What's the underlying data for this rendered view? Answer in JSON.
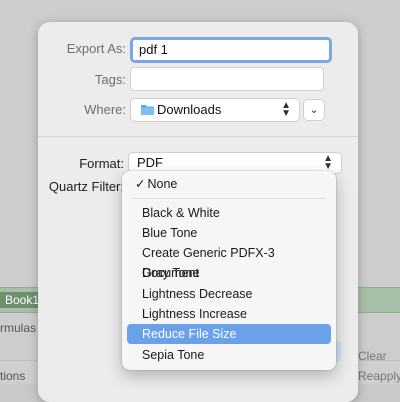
{
  "background": {
    "tab_book": "Book1",
    "tab_formulas": "rmulas",
    "tab_actions": "tions",
    "clear": "Clear",
    "reapply": "Reapply"
  },
  "sheet": {
    "export_as_label": "Export As:",
    "export_as_value": "pdf 1",
    "tags_label": "Tags:",
    "tags_value": "",
    "where_label": "Where:",
    "where_value": "Downloads",
    "format_label": "Format:",
    "format_value": "PDF",
    "quartz_label": "Quartz Filter:"
  },
  "menu": {
    "checked_item": "None",
    "items": [
      "Black & White",
      "Blue Tone",
      "Create Generic PDFX-3 Document",
      "Gray Tone",
      "Lightness Decrease",
      "Lightness Increase",
      "Reduce File Size",
      "Sepia Tone"
    ],
    "highlighted_item": "Reduce File Size"
  },
  "colors": {
    "accent": "#6aa1e9",
    "focus_ring": "#7aa7e6"
  },
  "icons": {
    "folder": "folder-icon",
    "updown": "updown-chevron-icon",
    "expand": "chevron-down-icon",
    "check": "checkmark-icon"
  }
}
